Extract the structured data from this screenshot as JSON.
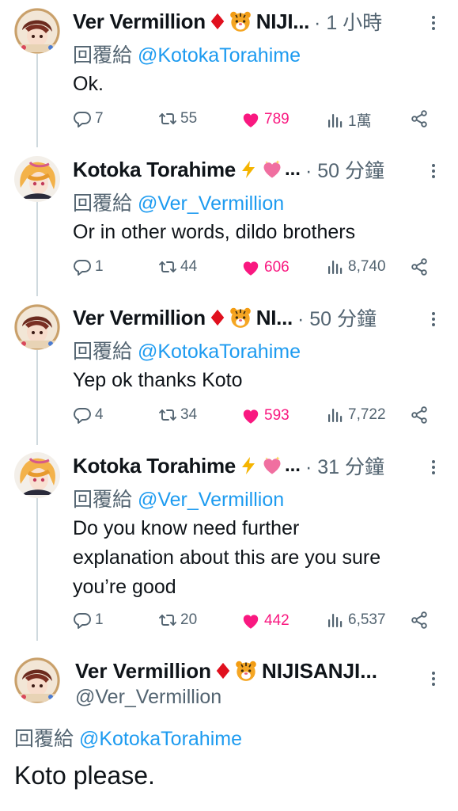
{
  "tweets": [
    {
      "name": "Ver Vermillion",
      "name_suffix": "NIJI...",
      "time": "· 1 小時",
      "reply_prefix": "回覆給",
      "reply_to": "@KotokaTorahime",
      "text": "Ok.",
      "replies": "7",
      "retweets": "55",
      "likes": "789",
      "views": "1萬"
    },
    {
      "name": "Kotoka Torahime",
      "name_suffix": "...",
      "time": "· 50 分鐘",
      "reply_prefix": "回覆給",
      "reply_to": "@Ver_Vermillion",
      "text": "Or in other words, dildo brothers",
      "replies": "1",
      "retweets": "44",
      "likes": "606",
      "views": "8,740"
    },
    {
      "name": "Ver Vermillion",
      "name_suffix": "NI...",
      "time": "· 50 分鐘",
      "reply_prefix": "回覆給",
      "reply_to": "@KotokaTorahime",
      "text": "Yep ok thanks Koto",
      "replies": "4",
      "retweets": "34",
      "likes": "593",
      "views": "7,722"
    },
    {
      "name": "Kotoka Torahime",
      "name_suffix": "...",
      "time": "· 31 分鐘",
      "reply_prefix": "回覆給",
      "reply_to": "@Ver_Vermillion",
      "text_lines": [
        "Do you know need further",
        "explanation about this are you sure",
        "you’re good"
      ],
      "replies": "1",
      "retweets": "20",
      "likes": "442",
      "views": "6,537"
    }
  ],
  "main_tweet": {
    "name": "Ver Vermillion",
    "name_suffix": "NIJISANJI...",
    "handle": "@Ver_Vermillion",
    "reply_prefix": "回覆給",
    "reply_to": "@KotokaTorahime",
    "text": "Koto please."
  },
  "icons": {
    "reply": "reply-icon",
    "retweet": "retweet-icon",
    "like": "heart-icon",
    "views": "views-icon",
    "share": "share-icon",
    "more": "more-icon",
    "diamond": "red-diamond-emoji",
    "tiger": "tiger-face-emoji",
    "lightning": "lightning-emoji",
    "heart_emoji": "sparkling-heart-emoji"
  },
  "colors": {
    "link": "#1d9bf0",
    "muted": "#536471",
    "like": "#f91880",
    "diamond": "#e0101e",
    "thread_line": "#cfd9de"
  }
}
